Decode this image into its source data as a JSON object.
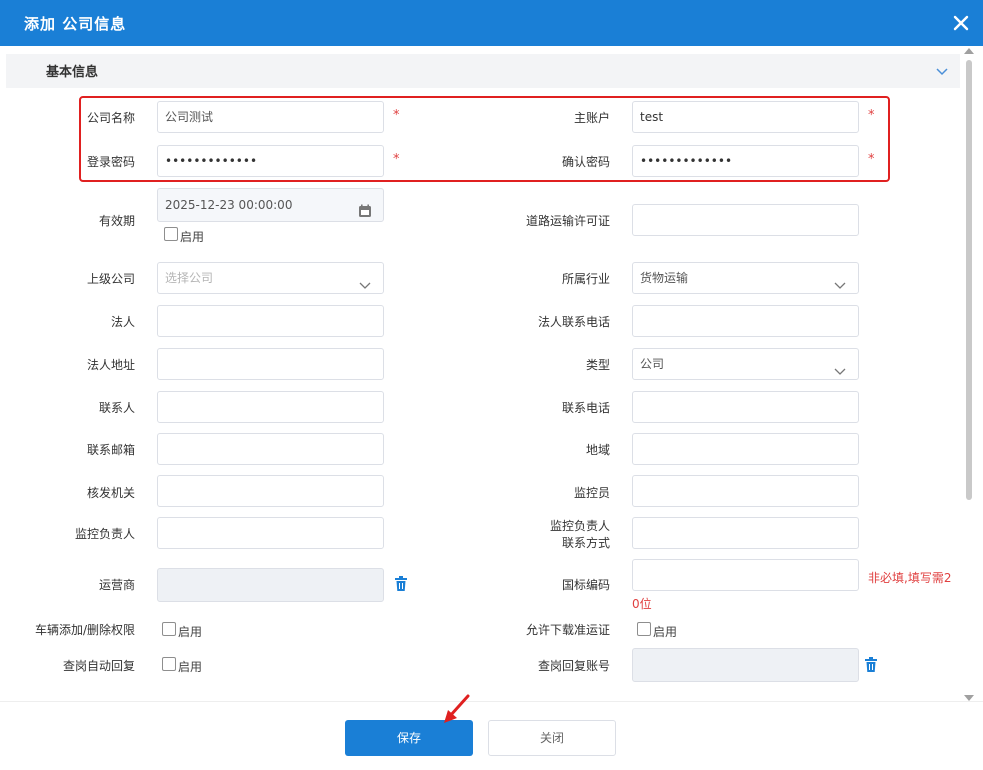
{
  "dialog": {
    "title": "添加   公司信息"
  },
  "section": {
    "label": "基本信息"
  },
  "fields": {
    "company_name": {
      "label": "公司名称",
      "value": "公司测试",
      "required": "*"
    },
    "main_account": {
      "label": "主账户",
      "value": "test",
      "required": "*"
    },
    "login_password": {
      "label": "登录密码",
      "value": "•••••••••••••",
      "required": "*"
    },
    "confirm_password": {
      "label": "确认密码",
      "value": "•••••••••••••",
      "required": "*"
    },
    "validity": {
      "label": "有效期",
      "value": "2025-12-23 00:00:00",
      "enable_label": "启用"
    },
    "road_license": {
      "label": "道路运输许可证",
      "value": ""
    },
    "parent_company": {
      "label": "上级公司",
      "placeholder": "选择公司"
    },
    "industry": {
      "label": "所属行业",
      "value": "货物运输"
    },
    "legal_person": {
      "label": "法人",
      "value": ""
    },
    "legal_phone": {
      "label": "法人联系电话",
      "value": ""
    },
    "legal_address": {
      "label": "法人地址",
      "value": ""
    },
    "type": {
      "label": "类型",
      "value": "公司"
    },
    "contact": {
      "label": "联系人",
      "value": ""
    },
    "contact_phone": {
      "label": "联系电话",
      "value": ""
    },
    "contact_email": {
      "label": "联系邮箱",
      "value": ""
    },
    "region": {
      "label": "地域",
      "value": ""
    },
    "issuing_authority": {
      "label": "核发机关",
      "value": ""
    },
    "monitor": {
      "label": "监控员",
      "value": ""
    },
    "monitor_head": {
      "label": "监控负责人",
      "value": ""
    },
    "monitor_head_contact": {
      "label_line1": "监控负责人",
      "label_line2": "联系方式",
      "value": ""
    },
    "operator": {
      "label": "运营商",
      "value": ""
    },
    "national_code": {
      "label": "国标编码",
      "value": "",
      "hint_line1": "非必填,填写需2",
      "hint_line2": "0位"
    },
    "vehicle_permission": {
      "label": "车辆添加/删除权限",
      "enable_label": "启用"
    },
    "allow_download": {
      "label": "允许下载准运证",
      "enable_label": "启用"
    },
    "auto_reply": {
      "label": "查岗自动回复",
      "enable_label": "启用"
    },
    "reply_account": {
      "label": "查岗回复账号",
      "value": ""
    }
  },
  "footer": {
    "save_label": "保存",
    "close_label": "关闭"
  },
  "colors": {
    "accent": "#1a7fd6",
    "required": "#e04040",
    "highlight_box": "#e02020"
  },
  "icons": [
    "close-icon",
    "chevron-down-icon",
    "calendar-icon",
    "trash-icon",
    "arrow-annotation"
  ]
}
